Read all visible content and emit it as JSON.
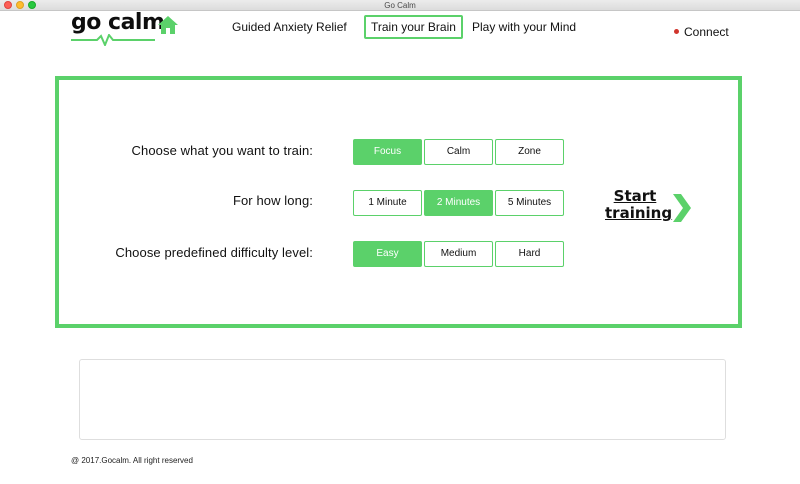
{
  "window": {
    "title": "Go Calm"
  },
  "logo": {
    "text": "go calm"
  },
  "nav": {
    "items": [
      {
        "label": "Guided Anxiety Relief"
      },
      {
        "label": "Train your Brain"
      },
      {
        "label": "Play with your Mind"
      }
    ],
    "active": "Train your Brain"
  },
  "connect": {
    "label": "Connect",
    "status_color": "#d0342c"
  },
  "training": {
    "rows": [
      {
        "label": "Choose what you want to train:",
        "options": [
          "Focus",
          "Calm",
          "Zone"
        ],
        "selected": "Focus"
      },
      {
        "label": "For how long:",
        "options": [
          "1 Minute",
          "2 Minutes",
          "5 Minutes"
        ],
        "selected": "2 Minutes"
      },
      {
        "label": "Choose predefined difficulty level:",
        "options": [
          "Easy",
          "Medium",
          "Hard"
        ],
        "selected": "Easy"
      }
    ],
    "start_label_line1": "Start",
    "start_label_line2": "training"
  },
  "footer": {
    "text": "@ 2017.Gocalm. All right reserved"
  },
  "colors": {
    "accent": "#5bd16a",
    "text": "#111111"
  },
  "icons": {
    "logo_home": "home-icon",
    "start_arrow": "chevron-right-icon"
  }
}
